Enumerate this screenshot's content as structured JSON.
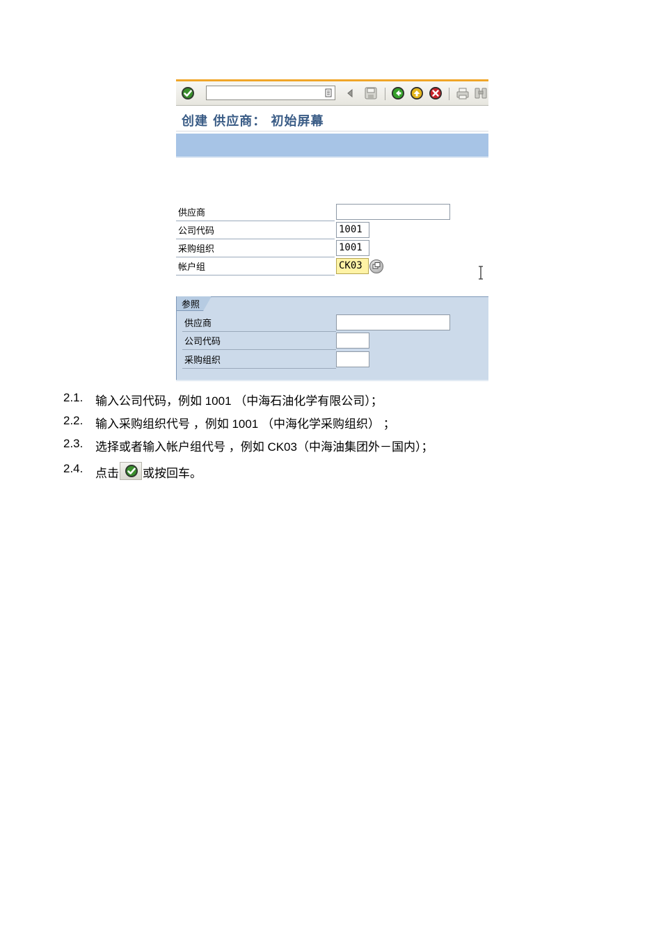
{
  "screen": {
    "title": "创建 供应商： 初始屏幕",
    "toolbar": {
      "command_field_value": "",
      "icons": [
        "enter-checkmark-icon",
        "dropdown-icon",
        "back-arrow-icon",
        "save-icon",
        "back-icon",
        "exit-icon",
        "cancel-icon",
        "print-icon",
        "find-icon"
      ]
    },
    "fields": [
      {
        "label": "供应商",
        "value": ""
      },
      {
        "label": "公司代码",
        "value": "1001"
      },
      {
        "label": "采购组织",
        "value": "1001"
      },
      {
        "label": "帐户组",
        "value": "CK03"
      }
    ],
    "reference": {
      "tab_label": "参照",
      "fields": [
        {
          "label": "供应商",
          "value": ""
        },
        {
          "label": "公司代码",
          "value": ""
        },
        {
          "label": "采购组织",
          "value": ""
        }
      ]
    }
  },
  "steps": [
    {
      "num": "2.1.",
      "text": "输入公司代码，例如 1001 （中海石油化学有限公司）；"
    },
    {
      "num": "2.2.",
      "text": "输入采购组织代号 ，例如 1001 （中海化学采购组织） ；"
    },
    {
      "num": "2.3.",
      "text": "选择或者输入帐户组代号 ，例如 CK03（中海油集团外－国内）；"
    },
    {
      "num": "2.4.",
      "text_before": "点击",
      "text_after": "或按回车。",
      "icon": "enter-checkmark-icon"
    }
  ],
  "colors": {
    "title": "#3a5c86",
    "toolbar_accent": "#f0a629",
    "application_toolbar": "#a7c4e6",
    "reference_box": "#ccdaea",
    "required_field": "#fff3a6"
  }
}
